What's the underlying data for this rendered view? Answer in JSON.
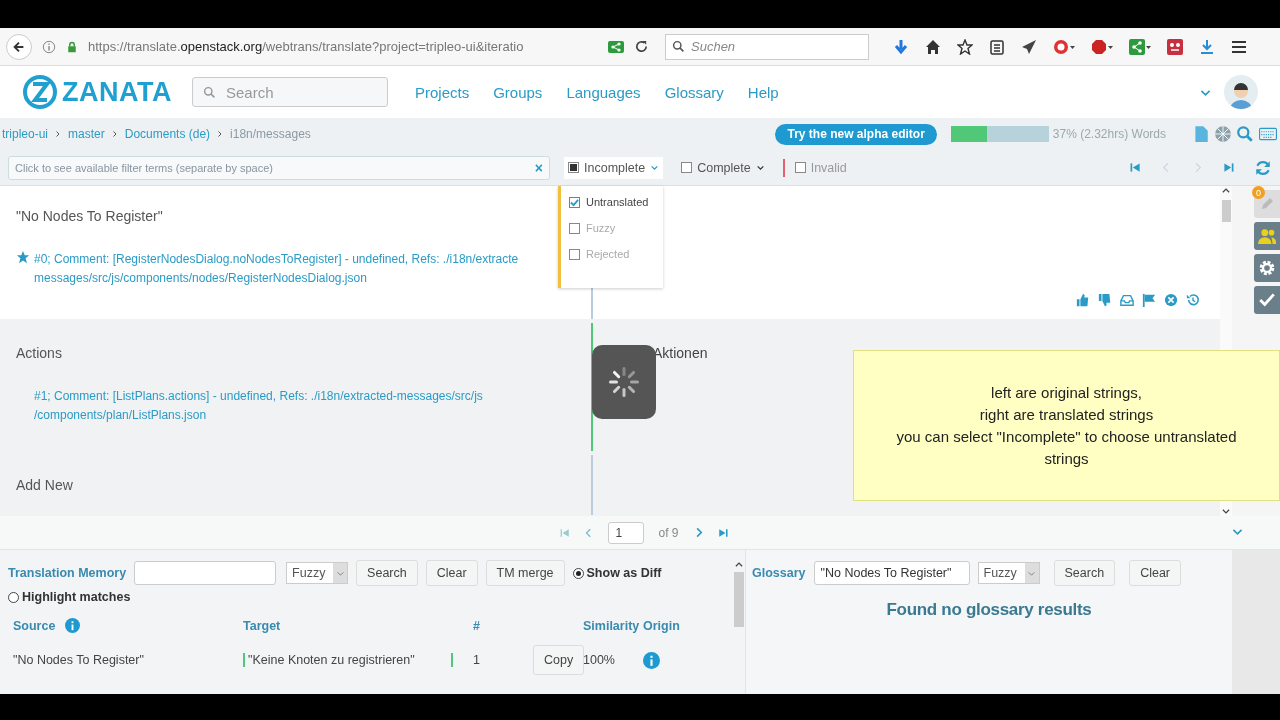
{
  "browser": {
    "url_start": "https://translate.",
    "url_domain": "openstack.org",
    "url_end": "/webtrans/translate?project=tripleo-ui&iteratio",
    "search_placeholder": "Suchen"
  },
  "header": {
    "logo": "ZANATA",
    "search_placeholder": "Search",
    "nav": [
      "Projects",
      "Groups",
      "Languages",
      "Glossary",
      "Help"
    ]
  },
  "breadcrumbs": [
    {
      "label": "tripleo-ui",
      "current": false
    },
    {
      "label": "master",
      "current": false
    },
    {
      "label": "Documents (de)",
      "current": false
    },
    {
      "label": "i18n/messages",
      "current": true
    }
  ],
  "alpha_button": "Try the new alpha editor",
  "progress": {
    "level": 0.37,
    "reading": "37% (2.32hrs) Words"
  },
  "filter": {
    "placeholder": "Click to see available filter terms (separate by space)",
    "clear": "×"
  },
  "status_filters": [
    {
      "label": "Incomplete",
      "checked": true,
      "indeterminate": true,
      "dropdown": true
    },
    {
      "label": "Complete",
      "checked": false,
      "dropdown": true
    },
    {
      "label": "Invalid",
      "checked": false,
      "dropdown": false
    }
  ],
  "filter_menu": [
    {
      "label": "Untranslated",
      "checked": true,
      "disabled": false
    },
    {
      "label": "Fuzzy",
      "checked": false,
      "disabled": true
    },
    {
      "label": "Rejected",
      "checked": false,
      "disabled": true
    }
  ],
  "rows": [
    {
      "source": "\"No Nodes To Register\"",
      "comment_lines": [
        "#0; Comment: [RegisterNodesDialog.noNodesToRegister] - undefined, Refs: ./i18n/extracte",
        "messages/src/js/components/nodes/RegisterNodesDialog.json"
      ],
      "target": "",
      "selected": true,
      "translated": false
    },
    {
      "source": "Actions",
      "comment_lines": [
        "#1; Comment: [ListPlans.actions] - undefined, Refs: ./i18n/extracted-messages/src/js",
        "/components/plan/ListPlans.json"
      ],
      "target": "Aktionen",
      "selected": false,
      "translated": true
    },
    {
      "source": "Add New",
      "comment_lines": [],
      "target": "",
      "selected": false,
      "translated": false
    }
  ],
  "note": {
    "lines": [
      "left are original strings,",
      "right are translated strings",
      "you can select \"Incomplete\" to choose untranslated",
      "strings"
    ]
  },
  "pager": {
    "page": "1",
    "of": "of 9"
  },
  "sidebar": {
    "badge": "0"
  },
  "tm": {
    "label": "Translation Memory",
    "mode": "Fuzzy",
    "buttons": [
      "Search",
      "Clear",
      "TM merge"
    ],
    "options": [
      {
        "label": "Show as Diff",
        "selected": true
      },
      {
        "label": "Highlight matches",
        "selected": false
      }
    ],
    "columns": [
      "Source",
      "Target",
      "#",
      "Similarity",
      "Origin"
    ],
    "rows": [
      {
        "source": "\"No Nodes To Register\"",
        "target": "\"Keine Knoten zu registrieren\"",
        "number": "1",
        "action": "Copy",
        "similarity": "100%"
      }
    ]
  },
  "glossary": {
    "label": "Glossary",
    "query": "\"No Nodes To Register\"",
    "mode": "Fuzzy",
    "buttons": [
      "Search",
      "Clear"
    ],
    "message": "Found no glossary results"
  }
}
